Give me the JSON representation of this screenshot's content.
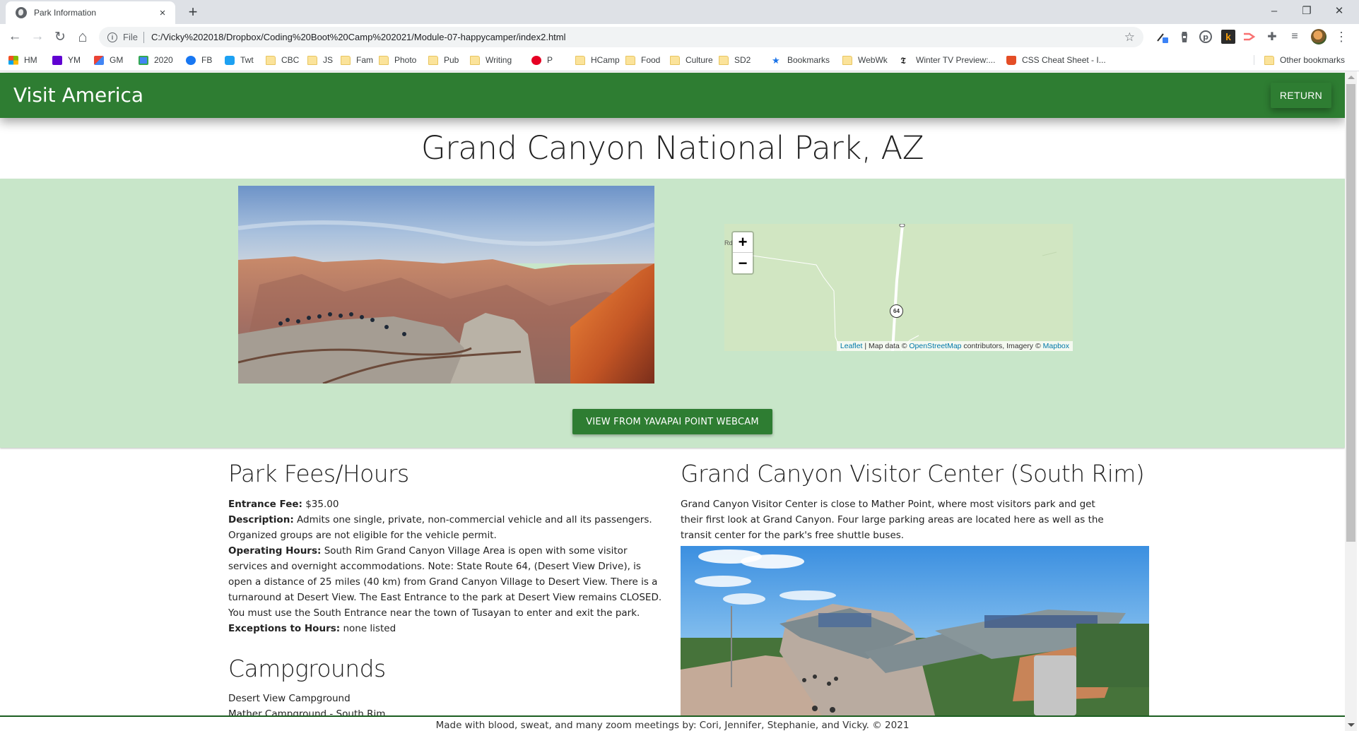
{
  "browser": {
    "tab_title": "Park Information",
    "tab_close": "×",
    "new_tab": "+",
    "window_controls": {
      "minimize": "–",
      "restore": "❐",
      "close": "✕"
    },
    "nav": {
      "back": "←",
      "forward": "→",
      "reload": "↻",
      "home": "⌂"
    },
    "address": {
      "scheme_label": "File",
      "url": "C:/Vicky%202018/Dropbox/Coding%20Boot%20Camp%202021/Module-07-happycamper/index2.html"
    },
    "bookmark_star": "☆",
    "extensions": [
      "eyedropper-extension",
      "lighthouse-extension",
      "pinterest-extension",
      "k-extension",
      "cast-extension",
      "puzzle-extensions",
      "media-queue"
    ],
    "menu": "⋮",
    "bookmarks": [
      {
        "label": "HM",
        "icon": "microsoft-icon"
      },
      {
        "label": "YM",
        "icon": "yahoo-mail-icon"
      },
      {
        "label": "GM",
        "icon": "gmail-icon"
      },
      {
        "label": "2020",
        "icon": "calendar-icon"
      },
      {
        "label": "FB",
        "icon": "facebook-icon"
      },
      {
        "label": "Twt",
        "icon": "twitter-icon"
      },
      {
        "label": "CBC",
        "icon": "folder-icon"
      },
      {
        "label": "JS",
        "icon": "folder-icon"
      },
      {
        "label": "Fam",
        "icon": "folder-icon"
      },
      {
        "label": "Photo",
        "icon": "folder-icon"
      },
      {
        "label": "Pub",
        "icon": "folder-icon"
      },
      {
        "label": "Writing",
        "icon": "folder-icon"
      },
      {
        "label": "P",
        "icon": "pinterest-icon"
      },
      {
        "label": "HCamp",
        "icon": "folder-icon"
      },
      {
        "label": "Food",
        "icon": "folder-icon"
      },
      {
        "label": "Culture",
        "icon": "folder-icon"
      },
      {
        "label": "SD2",
        "icon": "folder-icon"
      },
      {
        "label": "Bookmarks",
        "icon": "star-icon"
      },
      {
        "label": "WebWk",
        "icon": "folder-icon"
      },
      {
        "label": "Winter TV Preview:...",
        "icon": "nyt-icon"
      },
      {
        "label": "CSS Cheat Sheet - I...",
        "icon": "html5-icon"
      }
    ],
    "other_bookmarks": "Other bookmarks"
  },
  "header": {
    "brand": "Visit America",
    "return_label": "RETURN"
  },
  "page": {
    "title": "Grand Canyon National Park, AZ",
    "webcam_button": "VIEW FROM YAVAPAI POINT WEBCAM",
    "map": {
      "zoom_in": "+",
      "zoom_out": "−",
      "road_label": "Rd",
      "route_shield": "64",
      "attribution": {
        "leaflet": "Leaflet",
        "sep1": " | Map data © ",
        "osm": "OpenStreetMap",
        "mid": " contributors, Imagery © ",
        "mapbox": "Mapbox"
      }
    },
    "fees": {
      "heading": "Park Fees/Hours",
      "entrance_fee_label": "Entrance Fee:",
      "entrance_fee_value": " $35.00",
      "description_label": "Description:",
      "description_value": " Admits one single, private, non-commercial vehicle and all its passengers. Organized groups are not eligible for the vehicle permit.",
      "hours_label": "Operating Hours:",
      "hours_value": " South Rim Grand Canyon Village Area is open with some visitor services and overnight accommodations. Note: State Route 64, (Desert View Drive), is open a distance of 25 miles (40 km) from Grand Canyon Village to Desert View. There is a turnaround at Desert View. The East Entrance to the park at Desert View remains CLOSED. You must use the South Entrance near the town of Tusayan to enter and exit the park.",
      "exceptions_label": "Exceptions to Hours:",
      "exceptions_value": " none listed"
    },
    "campgrounds": {
      "heading": "Campgrounds",
      "items": [
        "Desert View Campground",
        "Mather Campground - South Rim"
      ]
    },
    "visitor_center": {
      "heading": "Grand Canyon Visitor Center (South Rim)",
      "description": "Grand Canyon Visitor Center is close to Mather Point, where most visitors park and get their first look at Grand Canyon. Four large parking areas are located here as well as the transit center for the park's free shuttle buses."
    },
    "footer": "Made with blood, sweat, and many zoom meetings by: Cori, Jennifer, Stephanie, and Vicky. © 2021"
  },
  "colors": {
    "brand_green": "#2e7d32",
    "band_green": "#c8e6c9",
    "map_green": "#d1e6c2",
    "link_blue": "#0078a8",
    "footer_rule": "#1b5e20"
  }
}
